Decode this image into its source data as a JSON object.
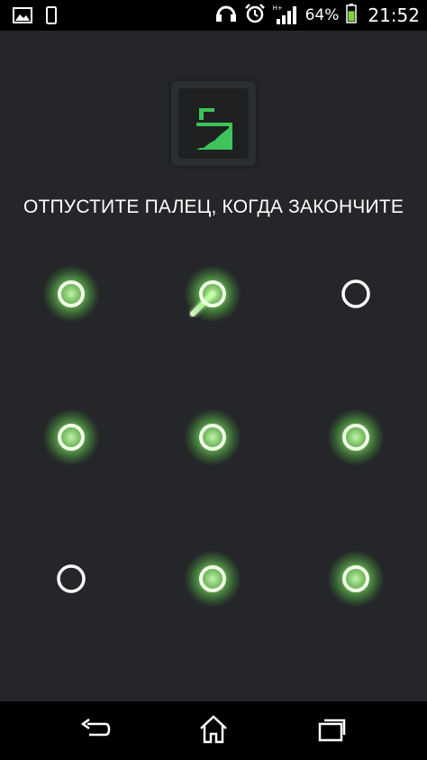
{
  "status_bar": {
    "icons_left": [
      "gallery-notification-icon",
      "phone-notification-icon"
    ],
    "icons_right": [
      "headset-icon",
      "alarm-clock-icon",
      "hplus-signal-icon",
      "battery-icon"
    ],
    "network_label": "H+",
    "battery_percent": "64%",
    "battery_level": 0.64,
    "time": "21:52"
  },
  "app": {
    "icon": "lock-icon",
    "accent_color": "#3ec45a"
  },
  "prompt": {
    "text": "ОТПУСТИТЕ ПАЛЕЦ, КОГДА ЗАКОНЧИТЕ"
  },
  "pattern": {
    "grid_size": 3,
    "selected_nodes": [
      [
        0,
        0
      ],
      [
        0,
        1
      ],
      [
        1,
        1
      ],
      [
        2,
        1
      ],
      [
        2,
        2
      ],
      [
        1,
        2
      ],
      [
        1,
        0
      ]
    ],
    "unselected_nodes": [
      [
        0,
        2
      ],
      [
        2,
        0
      ]
    ],
    "line_color": "#d8f5c8",
    "glow_color": "#8cff6a"
  },
  "nav_bar": {
    "buttons": [
      "back-icon",
      "home-icon",
      "recent-apps-icon"
    ]
  }
}
